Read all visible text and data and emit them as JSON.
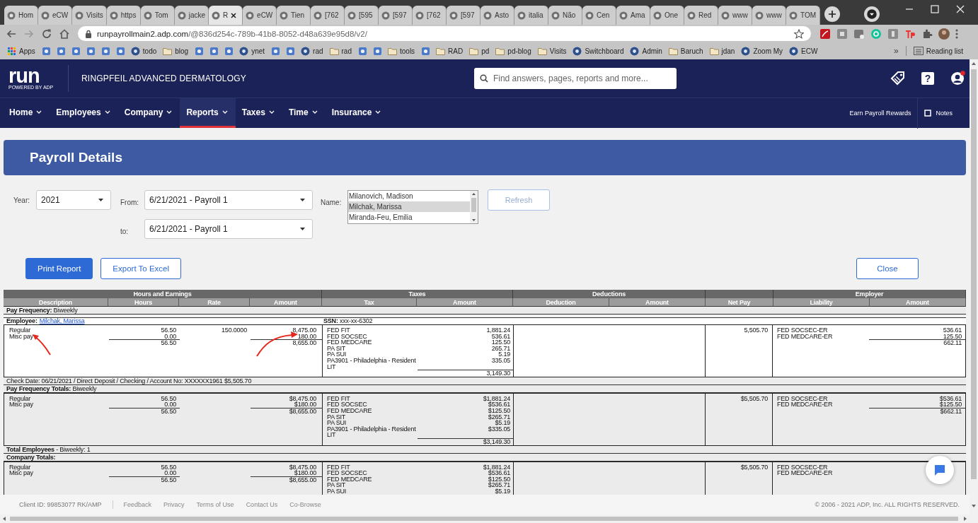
{
  "browser": {
    "tabs": [
      {
        "label": "Hom",
        "selected": false
      },
      {
        "label": "eCW",
        "selected": false
      },
      {
        "label": "Visits",
        "selected": false
      },
      {
        "label": "https",
        "selected": false
      },
      {
        "label": "Tom",
        "selected": false
      },
      {
        "label": "jacke",
        "selected": false
      },
      {
        "label": "R",
        "selected": true
      },
      {
        "label": "eCW",
        "selected": false
      },
      {
        "label": "Tien",
        "selected": false
      },
      {
        "label": "[762",
        "selected": false
      },
      {
        "label": "[595",
        "selected": false
      },
      {
        "label": "[597",
        "selected": false
      },
      {
        "label": "[762",
        "selected": false
      },
      {
        "label": "[597",
        "selected": false
      },
      {
        "label": "Asto",
        "selected": false
      },
      {
        "label": "italia",
        "selected": false
      },
      {
        "label": "Não",
        "selected": false
      },
      {
        "label": "Cen",
        "selected": false
      },
      {
        "label": "Ama",
        "selected": false
      },
      {
        "label": "One",
        "selected": false
      },
      {
        "label": "Red",
        "selected": false
      },
      {
        "label": "www",
        "selected": false
      },
      {
        "label": "www",
        "selected": false
      },
      {
        "label": "TOM",
        "selected": false
      }
    ],
    "url": {
      "host": "runpayrollmain2.adp.com",
      "path": "/@836d254c-789b-41b8-8052-d48a639e95d8/v2/"
    },
    "bookmarks": [
      {
        "kind": "apps",
        "label": "Apps"
      },
      {
        "kind": "icon"
      },
      {
        "kind": "icon"
      },
      {
        "kind": "icon"
      },
      {
        "kind": "icon"
      },
      {
        "kind": "icon"
      },
      {
        "kind": "icon"
      },
      {
        "kind": "site",
        "label": "todo"
      },
      {
        "kind": "folder",
        "label": "blog"
      },
      {
        "kind": "icon"
      },
      {
        "kind": "icon"
      },
      {
        "kind": "icon"
      },
      {
        "kind": "site",
        "label": "ynet"
      },
      {
        "kind": "icon"
      },
      {
        "kind": "icon"
      },
      {
        "kind": "site",
        "label": "rad"
      },
      {
        "kind": "folder",
        "label": "rad"
      },
      {
        "kind": "icon"
      },
      {
        "kind": "icon"
      },
      {
        "kind": "folder",
        "label": "tools"
      },
      {
        "kind": "icon"
      },
      {
        "kind": "folder",
        "label": "RAD"
      },
      {
        "kind": "folder",
        "label": "pd"
      },
      {
        "kind": "folder",
        "label": "pd-blog"
      },
      {
        "kind": "folder",
        "label": "Visits"
      },
      {
        "kind": "site",
        "label": "Switchboard"
      },
      {
        "kind": "site",
        "label": "Admin"
      },
      {
        "kind": "folder",
        "label": "Baruch"
      },
      {
        "kind": "folder",
        "label": "jdan"
      },
      {
        "kind": "site",
        "label": "Zoom My"
      },
      {
        "kind": "site",
        "label": "ECW"
      }
    ],
    "more": "»",
    "reading_list": "Reading list"
  },
  "app": {
    "logo": "run",
    "tagline": "POWERED BY ADP",
    "company": "RINGPFEIL ADVANCED DERMATOLOGY",
    "search": {
      "placeholder": "Find answers, pages, reports and more..."
    },
    "help": "?",
    "nav": [
      {
        "label": "Home",
        "selected": false
      },
      {
        "label": "Employees",
        "selected": false
      },
      {
        "label": "Company",
        "selected": false
      },
      {
        "label": "Reports",
        "selected": true
      },
      {
        "label": "Taxes",
        "selected": false
      },
      {
        "label": "Time",
        "selected": false
      },
      {
        "label": "Insurance",
        "selected": false
      }
    ],
    "rewards": "Earn Payroll Rewards",
    "notes": "Notes"
  },
  "page": {
    "title": "Payroll Details"
  },
  "filters": {
    "year_label": "Year:",
    "year": "2021",
    "from_label": "From:",
    "from": "6/21/2021 - Payroll 1",
    "to_label": "to:",
    "to": "6/21/2021 - Payroll 1",
    "name_label": "Name:",
    "names": [
      {
        "label": "Milanovich, Madison",
        "selected": false
      },
      {
        "label": "Milchak, Marissa",
        "selected": true
      },
      {
        "label": "Miranda-Feu, Emilia",
        "selected": false
      }
    ],
    "refresh": {
      "label": "Refresh",
      "disabled": true
    }
  },
  "actions": {
    "print": "Print Report",
    "export": "Export To Excel",
    "close": "Close"
  },
  "report": {
    "groups": [
      {
        "label": "Hours and Earnings",
        "columns": [
          "Description",
          "Hours",
          "Rate",
          "Amount"
        ]
      },
      {
        "label": "Taxes",
        "columns": [
          "Tax",
          "Amount"
        ]
      },
      {
        "label": "Deductions",
        "columns": [
          "Deduction",
          "Amount"
        ]
      },
      {
        "columns": [
          "Net Pay"
        ]
      },
      {
        "label": "Employer",
        "columns": [
          "Liability",
          "Amount"
        ]
      }
    ],
    "sections": [
      {
        "kind": "label",
        "text": "**Pay Frequency:** Biweekly",
        "bold": false
      },
      {
        "kind": "employee",
        "label": "Employee:",
        "name": "Milchak, Marissa",
        "ssn": "**SSN:** xxx-xx-6302"
      },
      {
        "kind": "detail",
        "shaded": false,
        "earnings": [
          {
            "description": "Regular",
            "hours": "56.50",
            "rate": "150.0000",
            "amount": "8,475.00"
          },
          {
            "description": "Misc pay",
            "hours": "0.00",
            "amount": "180.00"
          }
        ],
        "earnings_total": {
          "hours": "56.50",
          "amount": "8,655.00"
        },
        "taxes": [
          {
            "tax": "FED FIT",
            "amount": "1,881.24"
          },
          {
            "tax": "FED SOCSEC",
            "amount": "536.61"
          },
          {
            "tax": "FED MEDCARE",
            "amount": "125.50"
          },
          {
            "tax": "PA SIT",
            "amount": "265.71"
          },
          {
            "tax": "PA SUI",
            "amount": "5.19"
          },
          {
            "tax": "PA3901 - Philadelphia - Resident",
            "amount": "335.05"
          },
          {
            "tax": "LIT"
          }
        ],
        "tax_total": "3,149.30",
        "net_pay": "5,505.70",
        "employer": [
          {
            "liability": "FED SOCSEC-ER",
            "amount": "536.61"
          },
          {
            "liability": "FED MEDCARE-ER",
            "amount": "125.50"
          }
        ],
        "employer_total": "662.11"
      },
      {
        "kind": "label",
        "text": "Check Date: 06/21/2021 / Direct Deposit / Checking / Account No: XXXXXX1961 $5,505.70",
        "bold": false
      },
      {
        "kind": "label",
        "text": "**Pay Frequency Totals:** Biweekly",
        "bold": false
      },
      {
        "kind": "detail",
        "shaded": true,
        "earnings": [
          {
            "description": "Regular",
            "hours": "56.50",
            "amount": "$8,475.00"
          },
          {
            "description": "Misc pay",
            "hours": "0.00",
            "amount": "$180.00"
          }
        ],
        "earnings_total": {
          "hours": "56.50",
          "amount": "$8,655.00"
        },
        "taxes": [
          {
            "tax": "FED FIT",
            "amount": "$1,881.24"
          },
          {
            "tax": "FED SOCSEC",
            "amount": "$536.61"
          },
          {
            "tax": "FED MEDCARE",
            "amount": "$125.50"
          },
          {
            "tax": "PA SIT",
            "amount": "$265.71"
          },
          {
            "tax": "PA SUI",
            "amount": "$5.19"
          },
          {
            "tax": "PA3901 - Philadelphia - Resident",
            "amount": "$335.05"
          },
          {
            "tax": "LIT"
          }
        ],
        "tax_total": "$3,149.30",
        "net_pay": "$5,505.70",
        "employer": [
          {
            "liability": "FED SOCSEC-ER",
            "amount": "$536.61"
          },
          {
            "liability": "FED MEDCARE-ER",
            "amount": "$125.50"
          }
        ],
        "employer_total": "$662.11"
      },
      {
        "kind": "label",
        "text": "**Total Employees** - Biweekly: 1",
        "bold": false
      },
      {
        "kind": "label",
        "text": "Company Totals:",
        "bold": true
      },
      {
        "kind": "detail",
        "shaded": true,
        "earnings": [
          {
            "description": "Regular",
            "hours": "56.50",
            "amount": "$8,475.00"
          },
          {
            "description": "Misc pay",
            "hours": "0.00",
            "amount": "$180.00"
          }
        ],
        "earnings_total": {
          "hours": "56.50",
          "amount": "$8,655.00"
        },
        "taxes": [
          {
            "tax": "FED FIT",
            "amount": "$1,881.24"
          },
          {
            "tax": "FED SOCSEC",
            "amount": "$536.61"
          },
          {
            "tax": "FED MEDCARE",
            "amount": "$125.50"
          },
          {
            "tax": "PA SIT",
            "amount": "$265.71"
          },
          {
            "tax": "PA SUI",
            "amount": "$5.19"
          }
        ],
        "net_pay": "$5,505.70",
        "employer": [
          {
            "liability": "FED SOCSEC-ER"
          },
          {
            "liability": "FED MEDCARE-ER"
          }
        ]
      }
    ]
  },
  "footer": {
    "client": "Client ID: 99853077 RK/AMP",
    "links": [
      "Feedback",
      "Privacy",
      "Terms of Use",
      "Contact Us",
      "Co-Browse"
    ],
    "copyright": "© 2006 - 2021 ADP, Inc. ALL RIGHTS RESERVED."
  }
}
